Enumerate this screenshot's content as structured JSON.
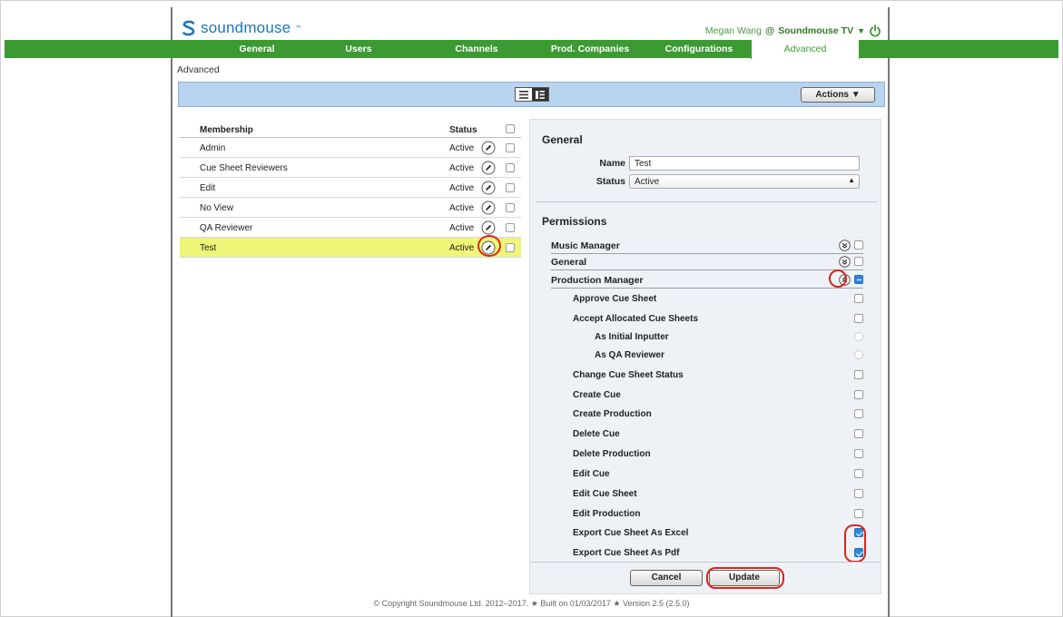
{
  "header": {
    "logo_text": "soundmouse",
    "user_name": "Megan Wang",
    "at_sign": "@",
    "organization": "Soundmouse TV",
    "caret": "▼"
  },
  "nav": {
    "tabs": [
      {
        "label": "General",
        "active": false
      },
      {
        "label": "Users",
        "active": false
      },
      {
        "label": "Channels",
        "active": false
      },
      {
        "label": "Prod. Companies",
        "active": false
      },
      {
        "label": "Configurations",
        "active": false
      },
      {
        "label": "Advanced",
        "active": true
      }
    ]
  },
  "page_title": "Advanced",
  "toolbar": {
    "actions_label": "Actions ▼"
  },
  "membership": {
    "col_membership": "Membership",
    "col_status": "Status",
    "rows": [
      {
        "name": "Admin",
        "status": "Active"
      },
      {
        "name": "Cue Sheet Reviewers",
        "status": "Active"
      },
      {
        "name": "Edit",
        "status": "Active"
      },
      {
        "name": "No View",
        "status": "Active"
      },
      {
        "name": "QA Reviewer",
        "status": "Active"
      },
      {
        "name": "Test",
        "status": "Active"
      }
    ],
    "selected_index": 5
  },
  "detail": {
    "general_title": "General",
    "name_label": "Name",
    "name_value": "Test",
    "status_label": "Status",
    "status_value": "Active",
    "permissions_title": "Permissions",
    "groups": [
      {
        "label": "Music Manager",
        "expanded": false
      },
      {
        "label": "General",
        "expanded": false
      },
      {
        "label": "Production Manager",
        "expanded": true
      }
    ],
    "permissions": [
      {
        "label": "Approve Cue Sheet",
        "checked": false,
        "type": "checkbox",
        "indent": 0
      },
      {
        "label": "Accept Allocated Cue Sheets",
        "checked": false,
        "type": "checkbox",
        "indent": 0
      },
      {
        "label": "As Initial Inputter",
        "checked": false,
        "type": "radio",
        "indent": 1
      },
      {
        "label": "As QA Reviewer",
        "checked": false,
        "type": "radio",
        "indent": 1
      },
      {
        "label": "Change Cue Sheet Status",
        "checked": false,
        "type": "checkbox",
        "indent": 0
      },
      {
        "label": "Create Cue",
        "checked": false,
        "type": "checkbox",
        "indent": 0
      },
      {
        "label": "Create Production",
        "checked": false,
        "type": "checkbox",
        "indent": 0
      },
      {
        "label": "Delete Cue",
        "checked": false,
        "type": "checkbox",
        "indent": 0
      },
      {
        "label": "Delete Production",
        "checked": false,
        "type": "checkbox",
        "indent": 0
      },
      {
        "label": "Edit Cue",
        "checked": false,
        "type": "checkbox",
        "indent": 0
      },
      {
        "label": "Edit Cue Sheet",
        "checked": false,
        "type": "checkbox",
        "indent": 0
      },
      {
        "label": "Edit Production",
        "checked": false,
        "type": "checkbox",
        "indent": 0
      },
      {
        "label": "Export Cue Sheet As Excel",
        "checked": true,
        "type": "checkbox",
        "indent": 0
      },
      {
        "label": "Export Cue Sheet As Pdf",
        "checked": true,
        "type": "checkbox",
        "indent": 0
      }
    ],
    "cancel_label": "Cancel",
    "update_label": "Update"
  },
  "footer": {
    "copyright": "© Copyright Soundmouse Ltd. 2012–2017. ★ Built on 01/03/2017 ★ Version 2.5 (2.5.0)"
  },
  "colors": {
    "nav_green": "#3b9a32",
    "brand_blue": "#1d76bb",
    "toolbar_blue": "#b9d4ef",
    "selected_row": "#eef578",
    "annotation_red": "#d9261c",
    "check_blue": "#2e86de"
  }
}
